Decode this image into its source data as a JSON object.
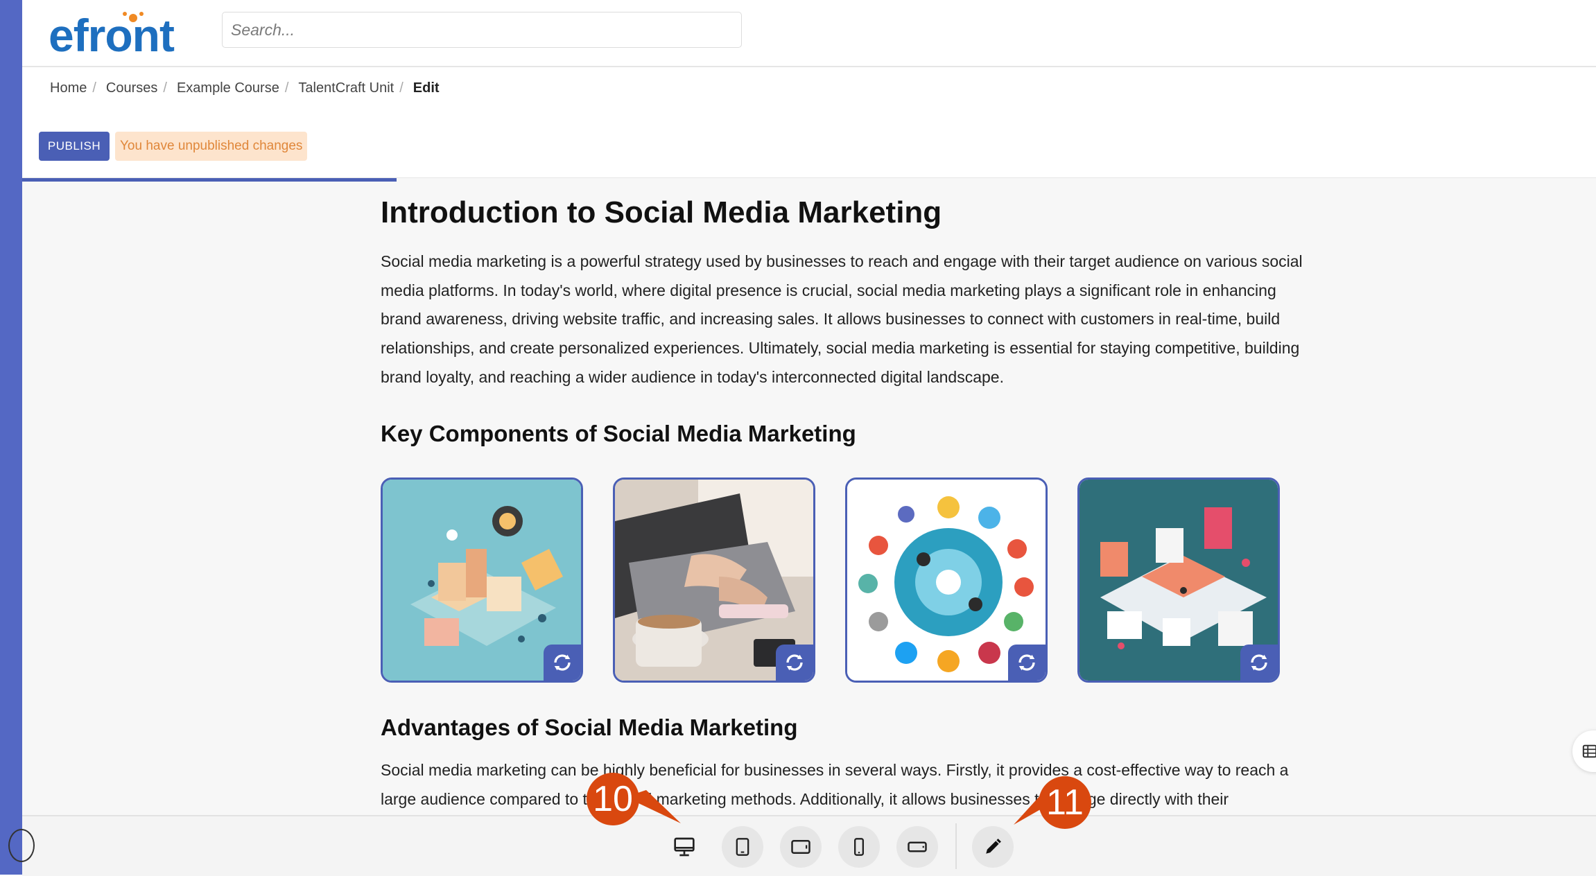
{
  "header": {
    "logo_text": "efront",
    "search": {
      "placeholder": "Search...",
      "value": ""
    }
  },
  "breadcrumb": [
    {
      "label": "Home"
    },
    {
      "label": "Courses"
    },
    {
      "label": "Example Course"
    },
    {
      "label": "TalentCraft Unit"
    },
    {
      "label": "Edit"
    }
  ],
  "actions": {
    "publish_label": "PUBLISH",
    "unpublished_notice": "You have unpublished changes"
  },
  "article": {
    "title": "Introduction to Social Media Marketing",
    "intro": "Social media marketing is a powerful strategy used by businesses to reach and engage with their target audience on various social media platforms. In today's world, where digital presence is crucial, social media marketing plays a significant role in enhancing brand awareness, driving website traffic, and increasing sales. It allows businesses to connect with customers in real-time, build relationships, and create personalized experiences. Ultimately, social media marketing is essential for staying competitive, building brand loyalty, and reaching a wider audience in today's interconnected digital landscape.",
    "section_components": "Key Components of Social Media Marketing",
    "section_advantages": "Advantages of Social Media Marketing",
    "advantages_text": "Social media marketing can be highly beneficial for businesses in several ways. Firstly, it provides a cost-effective way to reach a large audience compared to traditional marketing methods. Additionally, it allows businesses to engage directly with their"
  },
  "gallery": [
    {
      "icon": "refresh-icon"
    },
    {
      "icon": "refresh-icon"
    },
    {
      "icon": "refresh-icon"
    },
    {
      "icon": "refresh-icon"
    }
  ],
  "toolbar": {
    "buttons": [
      "desktop-icon",
      "tablet-portrait-icon",
      "tablet-landscape-icon",
      "phone-portrait-icon",
      "phone-landscape-icon",
      "pencil-icon"
    ]
  },
  "callouts": [
    "10",
    "11"
  ],
  "colors": {
    "accent": "#4a5fb5",
    "rail": "#5468c4",
    "badge_bg": "#fde4cd",
    "badge_text": "#e0873a",
    "callout": "#d9480f",
    "logo_blue": "#1e6fbf",
    "logo_orange": "#f08a24"
  }
}
